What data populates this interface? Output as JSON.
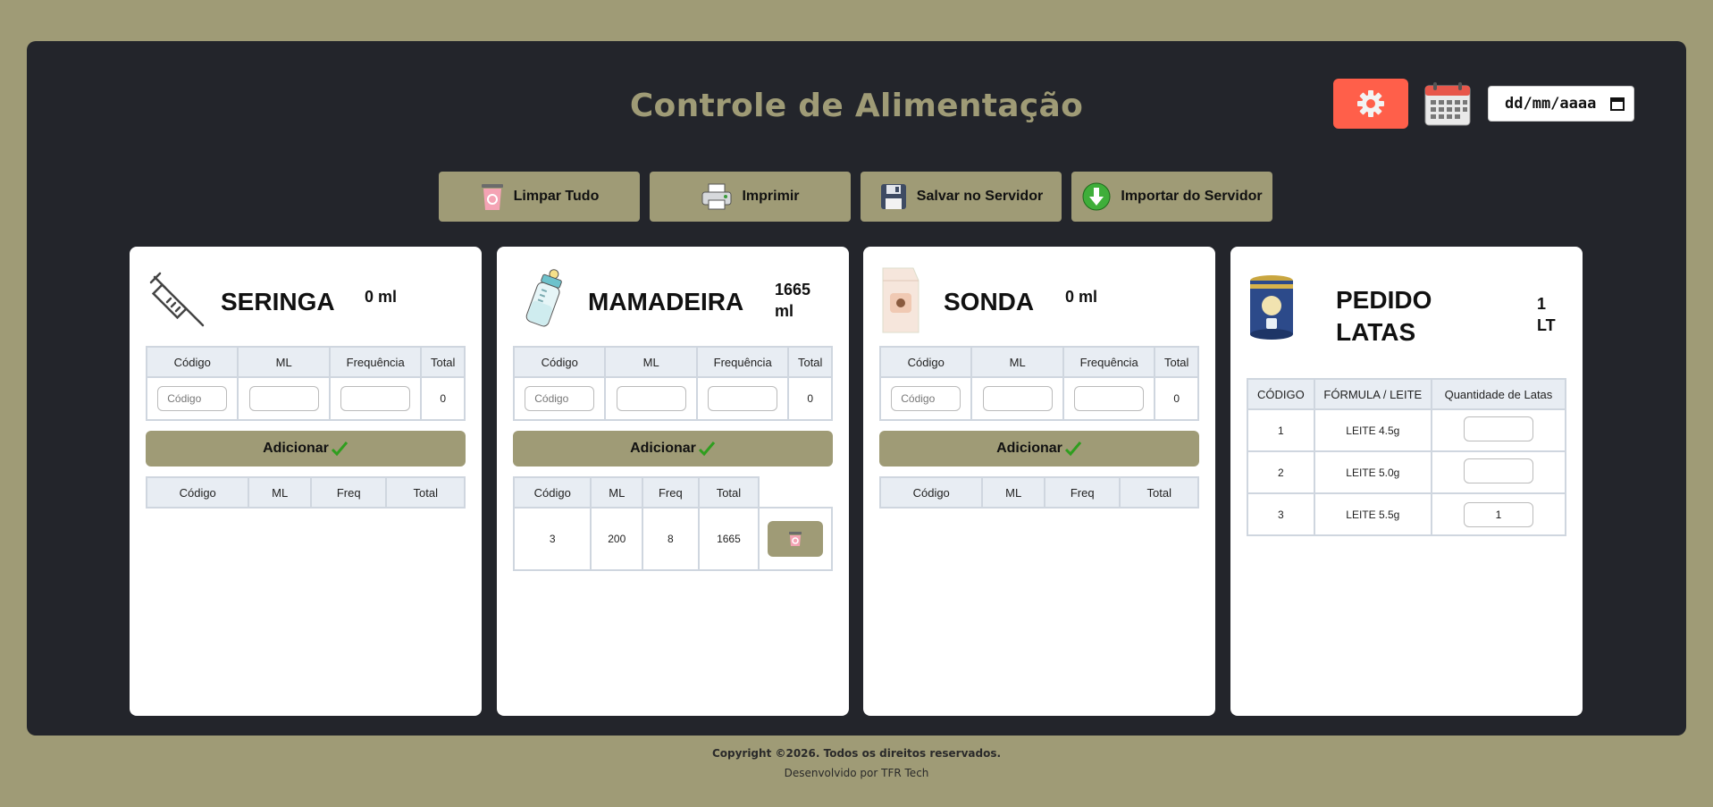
{
  "header": {
    "title": "Controle de Alimentação",
    "date_placeholder": "dd/mm/aaaa"
  },
  "toolbar": {
    "clear_label": "Limpar Tudo",
    "print_label": "Imprimir",
    "save_label": "Salvar no Servidor",
    "import_label": "Importar do Servidor"
  },
  "seringa": {
    "name": "SERINGA",
    "total_ml": "0 ml",
    "form_headers": [
      "Código",
      "ML",
      "Frequência",
      "Total"
    ],
    "code_placeholder": "Código",
    "form_total": "0",
    "add_label": "Adicionar",
    "list_headers": [
      "Código",
      "ML",
      "Freq",
      "Total"
    ]
  },
  "mamadeira": {
    "name": "MAMADEIRA",
    "total_ml": "1665 ml",
    "form_headers": [
      "Código",
      "ML",
      "Frequência",
      "Total"
    ],
    "code_placeholder": "Código",
    "form_total": "0",
    "add_label": "Adicionar",
    "list_headers": [
      "Código",
      "ML",
      "Freq",
      "Total"
    ],
    "rows": [
      {
        "codigo": "3",
        "ml": "200",
        "freq": "8",
        "total": "1665"
      }
    ]
  },
  "sonda": {
    "name": "SONDA",
    "total_ml": "0 ml",
    "form_headers": [
      "Código",
      "ML",
      "Frequência",
      "Total"
    ],
    "code_placeholder": "Código",
    "form_total": "0",
    "add_label": "Adicionar",
    "list_headers": [
      "Código",
      "ML",
      "Freq",
      "Total"
    ]
  },
  "pedido": {
    "name": "PEDIDO LATAS",
    "total": "1 LT",
    "headers": [
      "CÓDIGO",
      "FÓRMULA / LEITE",
      "Quantidade de Latas"
    ],
    "rows": [
      {
        "codigo": "1",
        "formula": "LEITE 4.5g",
        "qty": ""
      },
      {
        "codigo": "2",
        "formula": "LEITE 5.0g",
        "qty": ""
      },
      {
        "codigo": "3",
        "formula": "LEITE 5.5g",
        "qty": "1"
      }
    ]
  },
  "footer": {
    "copyright": "Copyright ©2026. Todos os direitos reservados.",
    "developer": "Desenvolvido por TFR Tech"
  },
  "colors": {
    "accent": "#9f9b76",
    "panel": "#23252b",
    "settings": "#ff5f4a"
  },
  "icons": [
    "settings-gear-icon",
    "calendar-icon",
    "trash-icon",
    "printer-icon",
    "floppy-disk-icon",
    "download-arrow-icon",
    "syringe-icon",
    "baby-bottle-icon",
    "milk-carton-icon",
    "formula-can-icon",
    "checkmark-icon"
  ]
}
